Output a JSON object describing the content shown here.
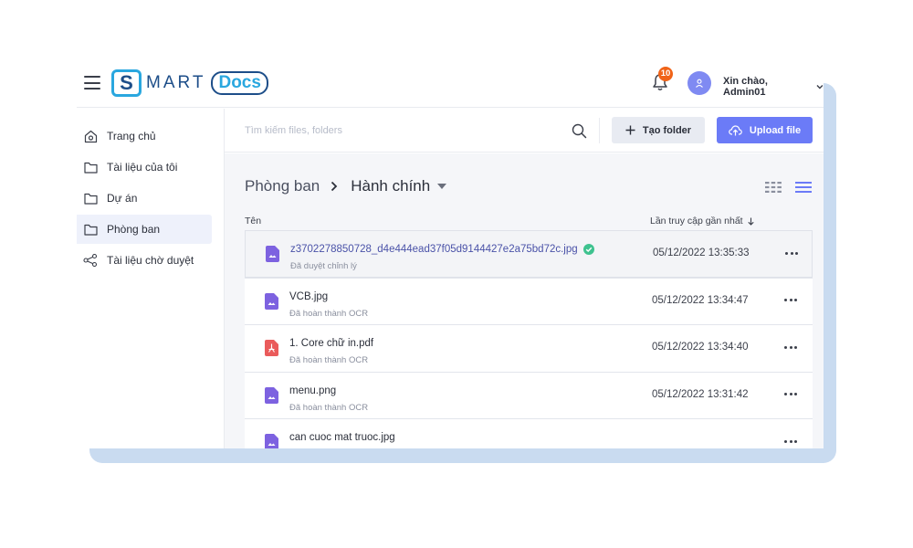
{
  "header": {
    "logo_mark": "S",
    "logo_text_1": "MART",
    "logo_text_2": "Docs",
    "notifications_count": "10",
    "greeting": "Xin chào, Admin01"
  },
  "sidebar": {
    "items": [
      {
        "label": "Trang chủ",
        "icon": "home-icon",
        "active": false
      },
      {
        "label": "Tài liệu của tôi",
        "icon": "folder-icon",
        "active": false
      },
      {
        "label": "Dự án",
        "icon": "folder-icon",
        "active": false
      },
      {
        "label": "Phòng ban",
        "icon": "folder-icon",
        "active": true
      },
      {
        "label": "Tài liệu chờ duyệt",
        "icon": "share-icon",
        "active": false
      }
    ]
  },
  "toolbar": {
    "search_placeholder": "Tìm kiếm files, folders",
    "create_folder_label": "Tạo folder",
    "upload_label": "Upload file"
  },
  "breadcrumb": {
    "parent": "Phòng ban",
    "current": "Hành chính"
  },
  "table": {
    "col_name": "Tên",
    "col_date": "Lần truy cập gần nhất",
    "rows": [
      {
        "name": "z3702278850728_d4e444ead37f05d9144427e2a75bd72c.jpg",
        "status": "Đã duyệt chỉnh lý",
        "date": "05/12/2022 13:35:33",
        "type": "image",
        "verified": true
      },
      {
        "name": "VCB.jpg",
        "status": "Đã hoàn thành OCR",
        "date": "05/12/2022 13:34:47",
        "type": "image",
        "verified": false
      },
      {
        "name": "1. Core chữ in.pdf",
        "status": "Đã hoàn thành OCR",
        "date": "05/12/2022 13:34:40",
        "type": "pdf",
        "verified": false
      },
      {
        "name": "menu.png",
        "status": "Đã hoàn thành OCR",
        "date": "05/12/2022 13:31:42",
        "type": "image",
        "verified": false
      },
      {
        "name": "can cuoc mat truoc.jpg",
        "status": "",
        "date": "",
        "type": "image",
        "verified": false
      }
    ]
  },
  "colors": {
    "accent": "#6b7bf7",
    "image_file": "#7d62e0",
    "pdf_file": "#ea5b5b",
    "verified": "#3ec28f",
    "badge": "#f06318",
    "frame": "#c9dbf0"
  }
}
